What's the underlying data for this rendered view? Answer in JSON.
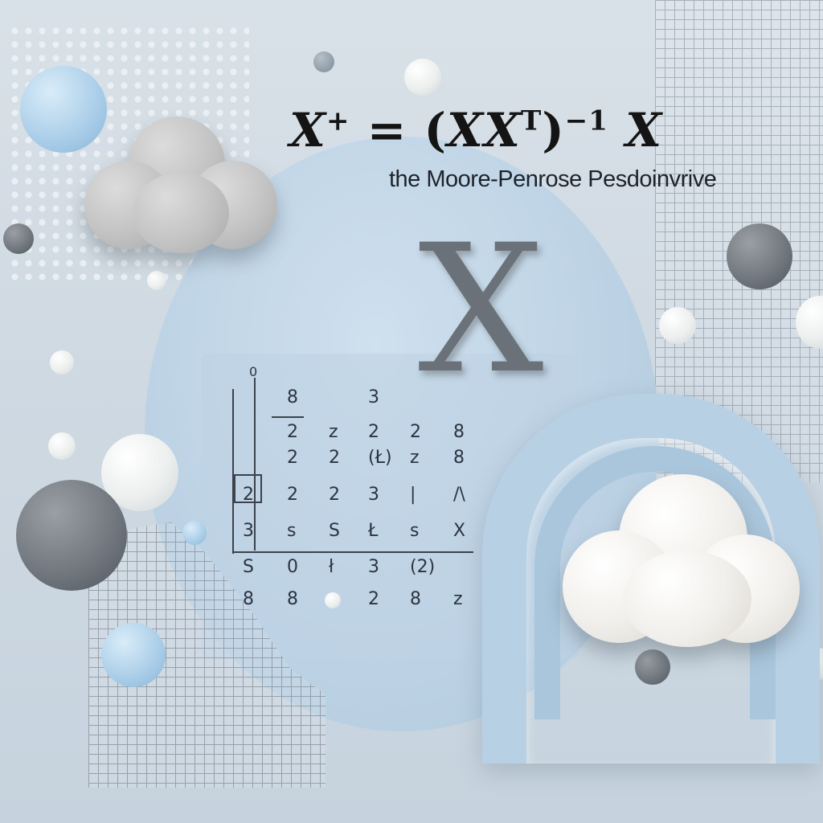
{
  "formula": {
    "lhs": "X",
    "lhs_sup": "+",
    "equals": "=",
    "open": "(",
    "inner": "XX",
    "inner_sup": "T",
    "close": ")",
    "exp": "−1",
    "rhs": "X"
  },
  "caption": "the Moore-Penrose  Pesdoinvrive",
  "big_symbol": "X",
  "matrix": {
    "corner": "0",
    "cells": [
      {
        "t": "8",
        "r": 0,
        "c": 1
      },
      {
        "t": "3",
        "r": 0,
        "c": 3
      },
      {
        "t": "2",
        "r": 1,
        "c": 1
      },
      {
        "t": "z",
        "r": 1,
        "c": 2
      },
      {
        "t": "2",
        "r": 1,
        "c": 3
      },
      {
        "t": "2",
        "r": 1,
        "c": 4
      },
      {
        "t": "8",
        "r": 1,
        "c": 5
      },
      {
        "t": "2",
        "r": 2,
        "c": 1
      },
      {
        "t": "2",
        "r": 2,
        "c": 2
      },
      {
        "t": "(Ł)",
        "r": 2,
        "c": 3
      },
      {
        "t": "z",
        "r": 2,
        "c": 4
      },
      {
        "t": "8",
        "r": 2,
        "c": 5
      },
      {
        "t": "2",
        "r": 3,
        "c": 0
      },
      {
        "t": "2",
        "r": 3,
        "c": 1
      },
      {
        "t": "2",
        "r": 3,
        "c": 2
      },
      {
        "t": "3",
        "r": 3,
        "c": 3
      },
      {
        "t": "|",
        "r": 3,
        "c": 4
      },
      {
        "t": "/\\",
        "r": 3,
        "c": 5
      },
      {
        "t": "3",
        "r": 4,
        "c": 0
      },
      {
        "t": "s",
        "r": 4,
        "c": 1
      },
      {
        "t": "S",
        "r": 4,
        "c": 2
      },
      {
        "t": "Ł",
        "r": 4,
        "c": 3
      },
      {
        "t": "s",
        "r": 4,
        "c": 4
      },
      {
        "t": "X",
        "r": 4,
        "c": 5
      },
      {
        "t": "S",
        "r": 5,
        "c": 0
      },
      {
        "t": "0",
        "r": 5,
        "c": 1
      },
      {
        "t": "ł",
        "r": 5,
        "c": 2
      },
      {
        "t": "3",
        "r": 5,
        "c": 3
      },
      {
        "t": "(2)",
        "r": 5,
        "c": 4
      },
      {
        "t": "8",
        "r": 6,
        "c": 0
      },
      {
        "t": "8",
        "r": 6,
        "c": 1
      },
      {
        "t": "2",
        "r": 6,
        "c": 3
      },
      {
        "t": "8",
        "r": 6,
        "c": 4
      },
      {
        "t": "z",
        "r": 6,
        "c": 5
      }
    ]
  },
  "colors": {
    "background": "#d2dce5",
    "accent_blue": "#a9cde8",
    "sphere_grey": "#6f757c",
    "text": "#141414"
  }
}
